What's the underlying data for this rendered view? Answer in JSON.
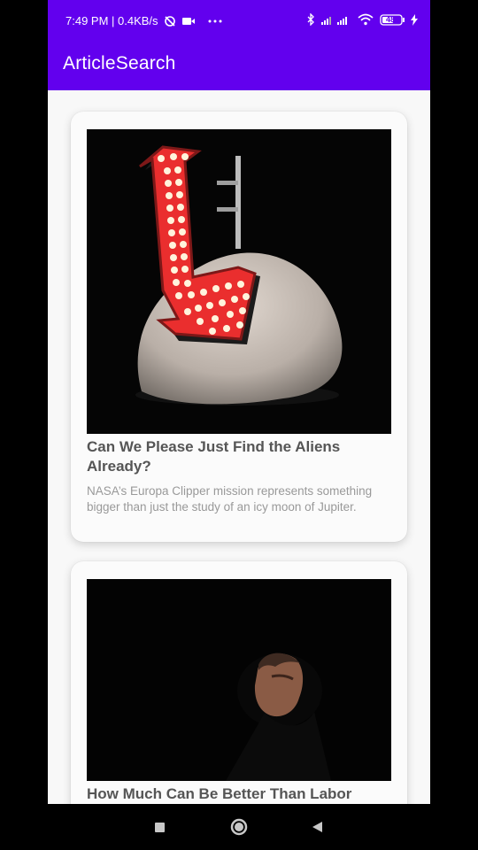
{
  "status_bar": {
    "time_speed": "7:49 PM | 0.4KB/s",
    "battery": "48",
    "icons": [
      "alarm-off-icon",
      "video-icon",
      "more-dots-icon",
      "bluetooth-icon",
      "signal-icon",
      "wifi-icon",
      "battery-icon",
      "charging-icon"
    ]
  },
  "app_bar": {
    "title": "ArticleSearch"
  },
  "articles": [
    {
      "title": "Can We Please Just Find the Aliens Already?",
      "description": "NASA’s Europa Clipper mission represents something bigger than just the study of an icy moon of Jupiter."
    },
    {
      "title": "How Much Can Be Better Than Labor"
    }
  ],
  "colors": {
    "primary": "#6200ee",
    "card_background": "#fbfbfb",
    "title_text": "#555555",
    "description_text": "#999999"
  },
  "nav": {
    "icons": [
      "recent-apps-icon",
      "home-icon",
      "back-icon"
    ]
  }
}
